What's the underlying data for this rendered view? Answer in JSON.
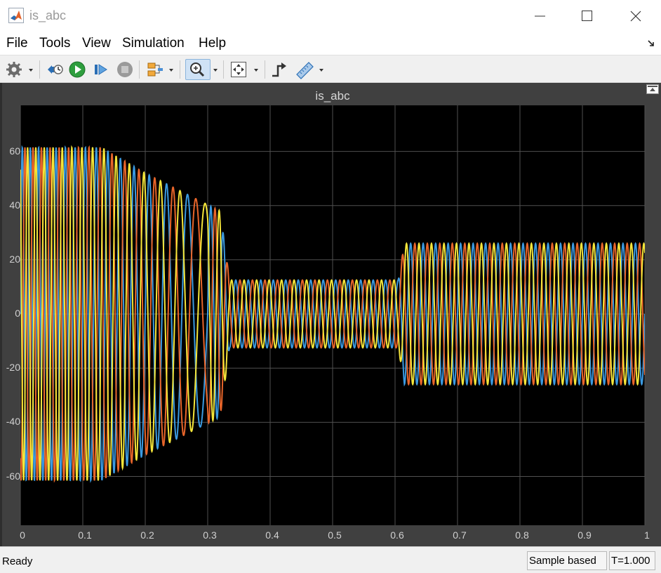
{
  "window": {
    "title": "is_abc",
    "icons": {
      "app": "matlab-logo-icon",
      "minimize": "minimize-icon",
      "maximize": "maximize-icon",
      "close": "close-icon"
    }
  },
  "menu": {
    "items": [
      "File",
      "Tools",
      "View",
      "Simulation",
      "Help"
    ],
    "undock_icon": "undock-arrow-icon"
  },
  "toolbar": {
    "buttons": [
      {
        "name": "settings",
        "icon": "gear-icon"
      },
      {
        "name": "step-back",
        "icon": "step-back-icon"
      },
      {
        "name": "run",
        "icon": "play-icon"
      },
      {
        "name": "step-forward",
        "icon": "step-forward-icon"
      },
      {
        "name": "stop",
        "icon": "stop-icon"
      },
      {
        "name": "highlight-block",
        "icon": "highlight-block-icon"
      },
      {
        "name": "zoom-in",
        "icon": "zoom-in-icon",
        "active": true
      },
      {
        "name": "fit-to-view",
        "icon": "fit-to-view-icon"
      },
      {
        "name": "triggers",
        "icon": "trigger-icon"
      },
      {
        "name": "measurements",
        "icon": "ruler-icon"
      }
    ]
  },
  "scope": {
    "restore_icon": "restore-layout-icon",
    "colors": {
      "background": "#404040",
      "axes": "#000000",
      "grid": "#505050",
      "text": "#d0d0d0"
    }
  },
  "chart_data": {
    "type": "line",
    "title": "is_abc",
    "xlabel": "",
    "ylabel": "",
    "xlim": [
      0,
      1
    ],
    "ylim": [
      -78,
      77
    ],
    "xticks": [
      "0",
      "0.1",
      "0.2",
      "0.3",
      "0.4",
      "0.5",
      "0.6",
      "0.7",
      "0.8",
      "0.9",
      "1"
    ],
    "yticks": [
      "60",
      "40",
      "20",
      "0",
      "-20",
      "-40",
      "-60"
    ],
    "ytick_values": [
      60,
      40,
      20,
      0,
      -20,
      -40,
      -60
    ],
    "grid": true,
    "frequency_hz": 50,
    "series": [
      {
        "color": "#3b9ae1",
        "phase_deg": 0
      },
      {
        "color": "#e8652a",
        "phase_deg": -120
      },
      {
        "color": "#f5e63a",
        "phase_deg": 120
      }
    ],
    "envelope": [
      {
        "t": 0,
        "amp": 61.5
      },
      {
        "t": 0.13,
        "amp": 61.5
      },
      {
        "t": 0.2,
        "amp": 52
      },
      {
        "t": 0.32,
        "amp": 38
      },
      {
        "t": 0.335,
        "amp": 12.5
      },
      {
        "t": 0.605,
        "amp": 12.5
      },
      {
        "t": 0.615,
        "amp": 26
      },
      {
        "t": 1.0,
        "amp": 26
      }
    ]
  },
  "status": {
    "state": "Ready",
    "mode": "Sample based",
    "time": "T=1.000"
  }
}
